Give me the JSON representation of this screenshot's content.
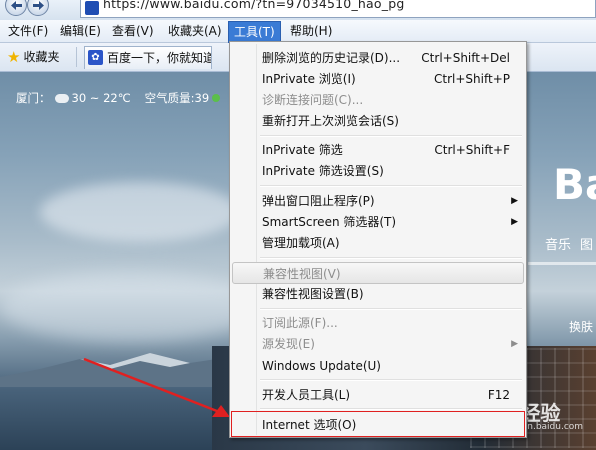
{
  "address_bar": {
    "url": "https://www.baidu.com/?tn=97034510_hao_pg"
  },
  "menubar": {
    "file": "文件(F)",
    "edit": "编辑(E)",
    "view": "查看(V)",
    "favorites": "收藏夹(A)",
    "tools": "工具(T)",
    "help": "帮助(H)"
  },
  "favorites_bar": {
    "favorites_label": "收藏夹",
    "tab_title": "百度一下，你就知道"
  },
  "page": {
    "weather_city": "厦门：",
    "weather_temp": "30 ~ 22℃",
    "air_quality": "空气质量:39",
    "logo_fragment": "Ba",
    "music_link": "音乐",
    "image_link": "图",
    "skin_link": "换肤",
    "watermark": "Bai 经验",
    "watermark_sub": "jingyan.baidu.com"
  },
  "tools_menu": {
    "items": [
      {
        "label": "删除浏览的历史记录(D)...",
        "accel": "Ctrl+Shift+Del",
        "enabled": true
      },
      {
        "label": "InPrivate 浏览(I)",
        "accel": "Ctrl+Shift+P",
        "enabled": true
      },
      {
        "label": "诊断连接问题(C)...",
        "accel": "",
        "enabled": false
      },
      {
        "label": "重新打开上次浏览会话(S)",
        "accel": "",
        "enabled": true
      },
      {
        "label": "InPrivate 筛选",
        "accel": "Ctrl+Shift+F",
        "enabled": true
      },
      {
        "label": "InPrivate 筛选设置(S)",
        "accel": "",
        "enabled": true
      },
      {
        "label": "弹出窗口阻止程序(P)",
        "accel": "",
        "enabled": true,
        "submenu": true
      },
      {
        "label": "SmartScreen 筛选器(T)",
        "accel": "",
        "enabled": true,
        "submenu": true
      },
      {
        "label": "管理加载项(A)",
        "accel": "",
        "enabled": true
      },
      {
        "label": "兼容性视图(V)",
        "accel": "",
        "enabled": false
      },
      {
        "label": "兼容性视图设置(B)",
        "accel": "",
        "enabled": true
      },
      {
        "label": "订阅此源(F)...",
        "accel": "",
        "enabled": false
      },
      {
        "label": "源发现(E)",
        "accel": "",
        "enabled": false,
        "submenu": true
      },
      {
        "label": "Windows Update(U)",
        "accel": "",
        "enabled": true
      },
      {
        "label": "开发人员工具(L)",
        "accel": "F12",
        "enabled": true
      },
      {
        "label": "Internet 选项(O)",
        "accel": "",
        "enabled": true
      }
    ]
  },
  "colors": {
    "menu_highlight": "#3a7bd5",
    "annotation_red": "#e02020"
  }
}
